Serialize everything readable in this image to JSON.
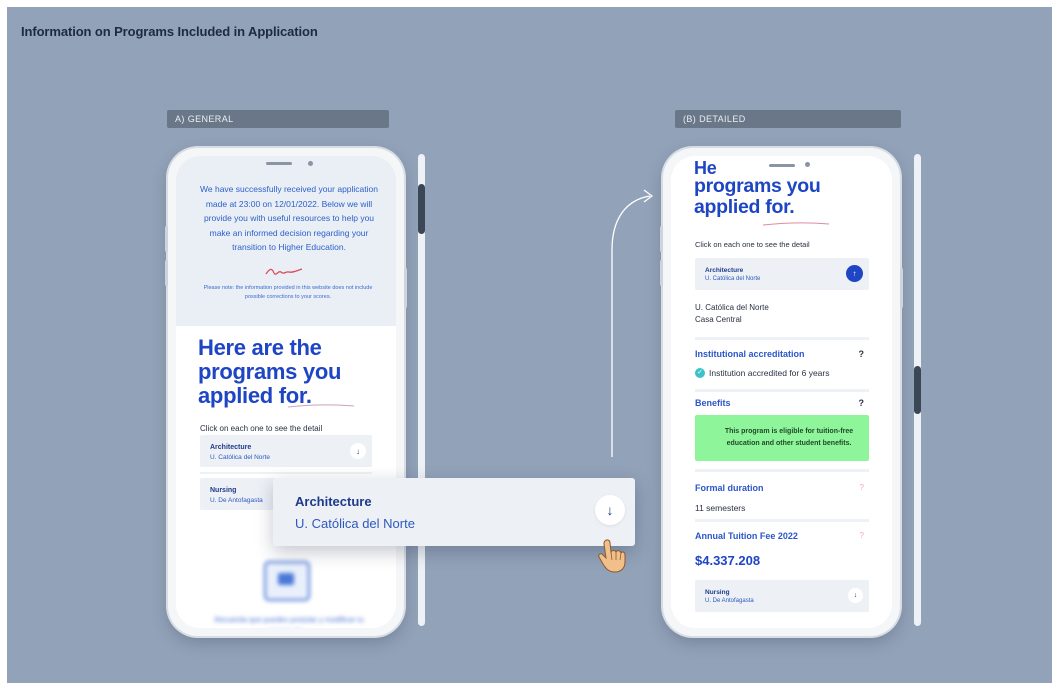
{
  "page_title": "Information on Programs Included in Application",
  "sections": {
    "a": "A) GENERAL",
    "b": "(B) DETAILED"
  },
  "phone_a": {
    "message": "We have successfully received your application made at 23:00 on 12/01/2022. Below we will provide you with useful resources to help you make an informed decision regarding your transition to Higher Education.",
    "note": "Please note: the information provided in this website does not include possible corrections to your scores.",
    "heading": "Here are the programs you applied for.",
    "instruction": "Click on each one to see the detail",
    "programs": [
      {
        "name": "Architecture",
        "university": "U. Católica del Norte"
      },
      {
        "name": "Nursing",
        "university": "U. De Antofagasta"
      }
    ],
    "blurred_text": "Recuerda que puedes postular y modificar tu postulación..."
  },
  "popup": {
    "name": "Architecture",
    "university": "U. Católica del Norte"
  },
  "phone_b": {
    "heading_partial": "He",
    "heading": "programs you applied for.",
    "instruction": "Click on each one to see the detail",
    "open_program": {
      "name": "Architecture",
      "university": "U. Católica del Norte"
    },
    "campus_line1": "U. Católica del Norte",
    "campus_line2": "Casa Central",
    "accreditation_label": "Institutional accreditation",
    "accreditation_value": "Institution accredited for 6 years",
    "benefits_label": "Benefits",
    "benefits_text": "This program is eligible for tuition-free education and other student benefits.",
    "duration_label": "Formal duration",
    "duration_value": "11 semesters",
    "fee_label": "Annual Tuition Fee 2022",
    "fee_value": "$4.337.208",
    "next_program": {
      "name": "Nursing",
      "university": "U. De Antofagasta"
    }
  },
  "help_symbol": "?",
  "colors": {
    "background": "#92a2b8",
    "brand_blue": "#1e45c4",
    "benefit_green": "#8ef59b",
    "check_teal": "#3cc3c8"
  }
}
